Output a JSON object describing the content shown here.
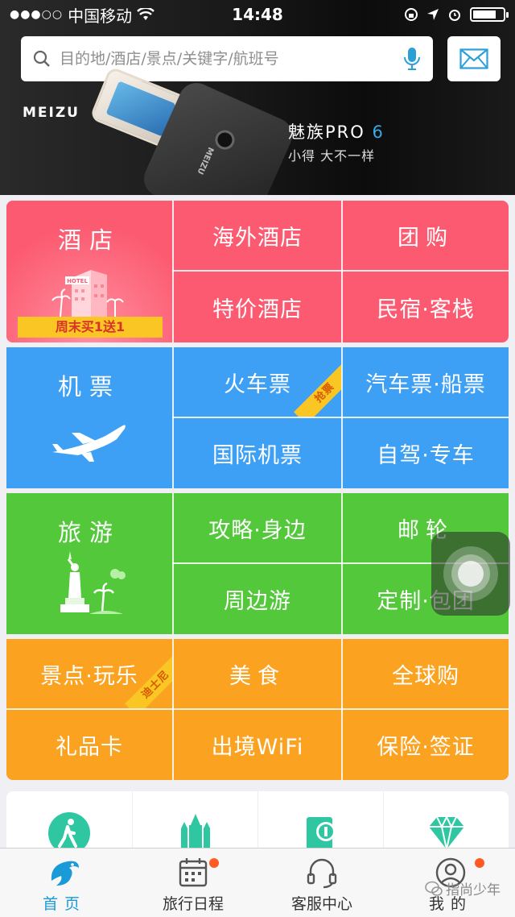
{
  "status_bar": {
    "carrier": "中国移动",
    "time": "14:48",
    "battery_level": 0.78
  },
  "search": {
    "placeholder": "目的地/酒店/景点/关键字/航班号",
    "icons": [
      "search-icon",
      "microphone-icon",
      "mail-icon"
    ]
  },
  "ad": {
    "brand": "MEIZU",
    "phone_label": "MEIZU",
    "title": "魅族PRO",
    "title_number": "6",
    "subtitle": "小得  大不一样"
  },
  "colors": {
    "hotel": "#fc5a70",
    "flight": "#3ea0f5",
    "travel": "#52c83a",
    "fun": "#fba321",
    "ribbon": "#f9c623"
  },
  "grid": {
    "hotel": {
      "main": "酒店",
      "banner": "周末买1送1",
      "hotel_sign": "HOTEL",
      "items": [
        "海外酒店",
        "团购",
        "特价酒店",
        "民宿·客栈"
      ]
    },
    "flight": {
      "main": "机票",
      "items": [
        "火车票",
        "汽车票·船票",
        "国际机票",
        "自驾·专车"
      ],
      "train_ribbon": "抢票"
    },
    "travel": {
      "main": "旅游",
      "items": [
        "攻略·身边",
        "邮轮",
        "周边游",
        "定制·包团"
      ]
    },
    "fun": {
      "items": [
        "景点·玩乐",
        "美食",
        "全球购",
        "礼品卡",
        "出境WiFi",
        "保险·签证"
      ],
      "ribbon": "迪士尼"
    }
  },
  "tabs": [
    {
      "label": "首页",
      "icon": "dolphin-icon",
      "active": true
    },
    {
      "label": "旅行日程",
      "icon": "calendar-icon",
      "badge": true
    },
    {
      "label": "客服中心",
      "icon": "headset-icon"
    },
    {
      "label": "我的",
      "icon": "user-icon",
      "badge": true
    }
  ],
  "watermark": "指尚少年"
}
